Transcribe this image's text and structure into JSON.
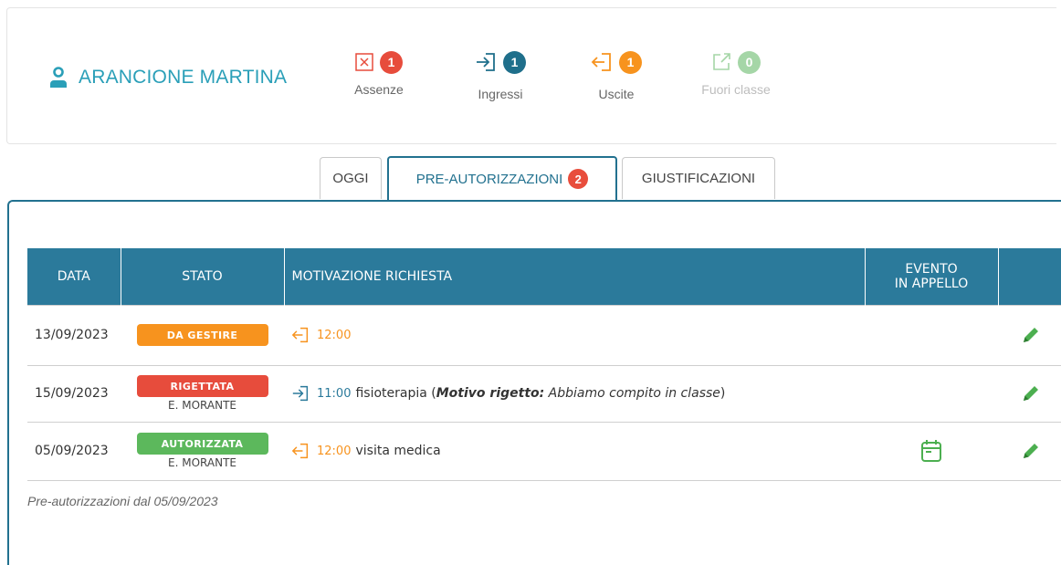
{
  "student": {
    "name": "ARANCIONE MARTINA"
  },
  "stats": [
    {
      "label": "Assenze",
      "count": "1",
      "color": "#e74c3c"
    },
    {
      "label": "Ingressi",
      "count": "1",
      "color": "#1f6f8b"
    },
    {
      "label": "Uscite",
      "count": "1",
      "color": "#f7931e"
    },
    {
      "label": "Fuori classe",
      "count": "0",
      "color": "#a5d6a7"
    }
  ],
  "tabs": [
    {
      "label": "OGGI"
    },
    {
      "label": "PRE-AUTORIZZAZIONI",
      "badge": "2"
    },
    {
      "label": "GIUSTIFICAZIONI"
    }
  ],
  "table": {
    "headers": {
      "date": "DATA",
      "state": "STATO",
      "reason": "MOTIVAZIONE RICHIESTA",
      "event_l1": "EVENTO",
      "event_l2": "IN APPELLO"
    },
    "rows": [
      {
        "date": "13/09/2023",
        "status": "DA GESTIRE",
        "teacher": "",
        "time": "12:00",
        "reason": "",
        "reject_label": "",
        "reject_reason": ""
      },
      {
        "date": "15/09/2023",
        "status": "RIGETTATA",
        "teacher": "E. MORANTE",
        "time": "11:00",
        "reason": "fisioterapia (",
        "reject_label": "Motivo rigetto:",
        "reject_reason": " Abbiamo compito in classe",
        "reason_end": ")"
      },
      {
        "date": "05/09/2023",
        "status": "AUTORIZZATA",
        "teacher": "E. MORANTE",
        "time": "12:00",
        "reason": "visita medica",
        "reject_label": "",
        "reject_reason": ""
      }
    ]
  },
  "footnote": "Pre-autorizzazioni dal 05/09/2023",
  "colors": {
    "accent": "#22718f",
    "header": "#2b7a9b",
    "teal": "#2a9fb8"
  }
}
